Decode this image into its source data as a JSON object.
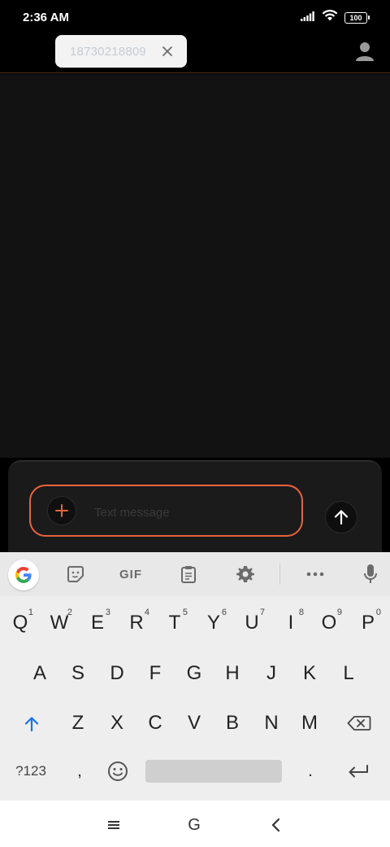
{
  "status_bar": {
    "time": "2:36 AM",
    "battery": "100",
    "icons": [
      "signal-icon",
      "wifi-icon",
      "battery-icon"
    ]
  },
  "header": {
    "recipient": "18730218809",
    "icons": [
      "close-icon",
      "contact-icon"
    ]
  },
  "compose": {
    "placeholder": "Text message",
    "icons": [
      "plus-icon",
      "send-arrow-icon"
    ]
  },
  "keyboard": {
    "toolbar": {
      "gif_label": "GIF",
      "icons": [
        "google-icon",
        "sticker-icon",
        "clipboard-icon",
        "settings-icon",
        "more-icon",
        "mic-icon"
      ]
    },
    "row1": [
      {
        "k": "Q",
        "h": "1"
      },
      {
        "k": "W",
        "h": "2"
      },
      {
        "k": "E",
        "h": "3"
      },
      {
        "k": "R",
        "h": "4"
      },
      {
        "k": "T",
        "h": "5"
      },
      {
        "k": "Y",
        "h": "6"
      },
      {
        "k": "U",
        "h": "7"
      },
      {
        "k": "I",
        "h": "8"
      },
      {
        "k": "O",
        "h": "9"
      },
      {
        "k": "P",
        "h": "0"
      }
    ],
    "row2": [
      "A",
      "S",
      "D",
      "F",
      "G",
      "H",
      "J",
      "K",
      "L"
    ],
    "row3": [
      "Z",
      "X",
      "C",
      "V",
      "B",
      "N",
      "M"
    ],
    "symbols_label": "?123",
    "comma": ",",
    "period": ".",
    "colors": {
      "shift": "#1a73e8",
      "background": "#eeeeee"
    }
  },
  "nav_bar": {
    "icons": [
      "menu-icon",
      "home-g-icon",
      "back-icon"
    ],
    "home_label": "G"
  },
  "colors": {
    "accent": "#e8643c",
    "conversation_bg": "#121212"
  }
}
